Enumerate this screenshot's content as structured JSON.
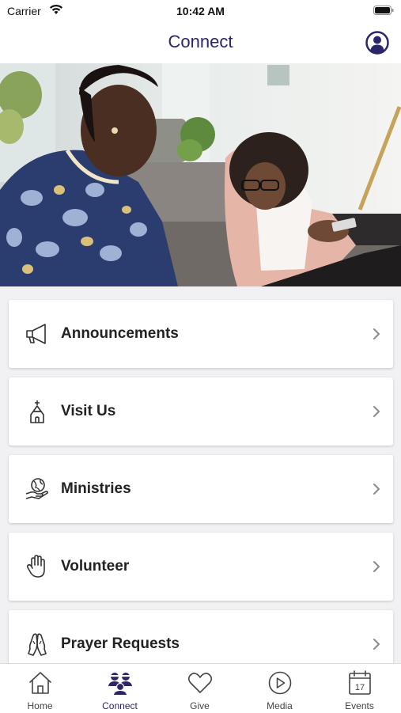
{
  "status_bar": {
    "carrier": "Carrier",
    "time": "10:42 AM"
  },
  "nav": {
    "title": "Connect"
  },
  "menu": [
    {
      "label": "Announcements",
      "icon": "megaphone-icon"
    },
    {
      "label": "Visit Us",
      "icon": "church-icon"
    },
    {
      "label": "Ministries",
      "icon": "globe-hand-icon"
    },
    {
      "label": "Volunteer",
      "icon": "raised-hand-icon"
    },
    {
      "label": "Prayer Requests",
      "icon": "praying-hands-icon"
    }
  ],
  "tabs": [
    {
      "label": "Home",
      "icon": "home-icon",
      "active": false
    },
    {
      "label": "Connect",
      "icon": "people-icon",
      "active": true
    },
    {
      "label": "Give",
      "icon": "heart-icon",
      "active": false
    },
    {
      "label": "Media",
      "icon": "play-icon",
      "active": false
    },
    {
      "label": "Events",
      "icon": "calendar-icon",
      "active": false,
      "calendar_day": "17"
    }
  ],
  "colors": {
    "accent": "#2b2669",
    "background": "#f1f1f3",
    "card": "#ffffff"
  }
}
